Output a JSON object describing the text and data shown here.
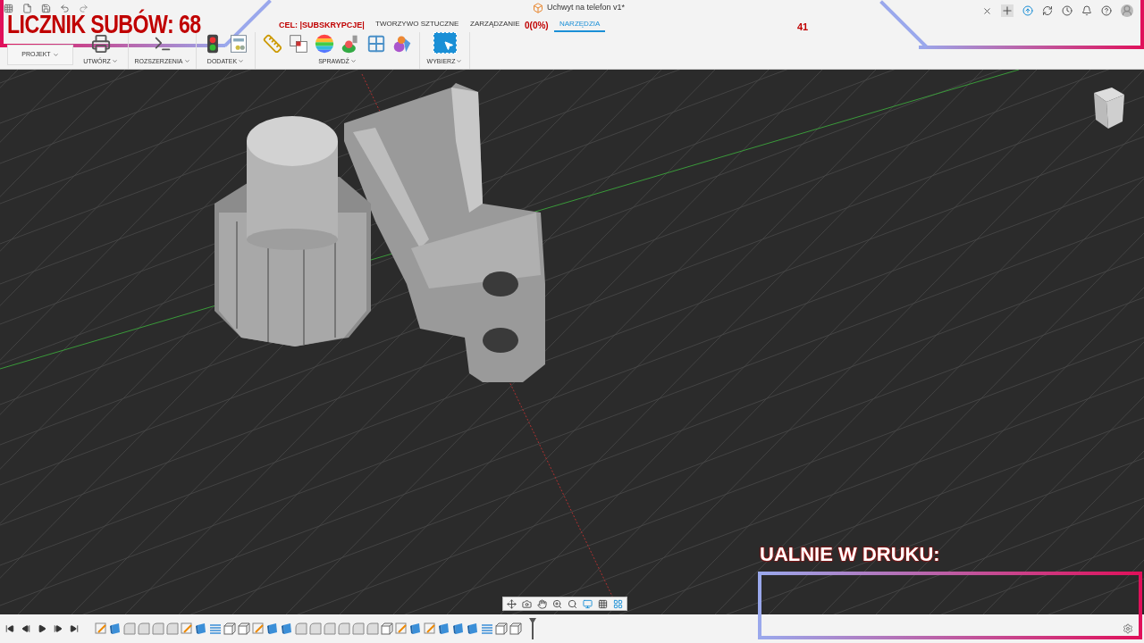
{
  "overlay": {
    "sub_counter": "LICZNIK SUBÓW: 68",
    "goal": "CEL: |SUBSKRYPCJE|",
    "progress": "0(0%)",
    "number": "41",
    "print_label": "UALNIE W DRUKU:"
  },
  "document_title": "Uchwyt na telefon v1*",
  "tabs": [
    {
      "label": "TWORZYWO SZTUCZNE",
      "selected": false
    },
    {
      "label": "ZARZĄDZANIE",
      "selected": false
    },
    {
      "label": "NARZĘDZIA",
      "selected": true
    }
  ],
  "project_button": "PROJEKT",
  "toolbar_groups": [
    {
      "label": "UTWÓRZ",
      "tools": [
        {
          "kind": "printer"
        }
      ]
    },
    {
      "label": "ROZSZERZENIA",
      "tools": [
        {
          "kind": "terminal"
        }
      ]
    },
    {
      "label": "DODATEK",
      "tools": [
        {
          "kind": "traffic"
        },
        {
          "kind": "report"
        }
      ]
    },
    {
      "label": "SPRAWDŹ",
      "tools": [
        {
          "kind": "measure"
        },
        {
          "kind": "interference"
        },
        {
          "kind": "curvature"
        },
        {
          "kind": "zebra"
        },
        {
          "kind": "section"
        },
        {
          "kind": "components"
        }
      ]
    },
    {
      "label": "WYBIERZ",
      "tools": [
        {
          "kind": "select"
        }
      ]
    }
  ],
  "timeline": [
    {
      "kind": "sketch"
    },
    {
      "kind": "body"
    },
    {
      "kind": "fillet"
    },
    {
      "kind": "fillet"
    },
    {
      "kind": "fillet"
    },
    {
      "kind": "fillet"
    },
    {
      "kind": "sketch"
    },
    {
      "kind": "body"
    },
    {
      "kind": "thread"
    },
    {
      "kind": "box"
    },
    {
      "kind": "box"
    },
    {
      "kind": "sketch"
    },
    {
      "kind": "body"
    },
    {
      "kind": "body"
    },
    {
      "kind": "fillet"
    },
    {
      "kind": "fillet"
    },
    {
      "kind": "fillet"
    },
    {
      "kind": "fillet"
    },
    {
      "kind": "fillet"
    },
    {
      "kind": "fillet"
    },
    {
      "kind": "box"
    },
    {
      "kind": "sketch"
    },
    {
      "kind": "body"
    },
    {
      "kind": "sketch"
    },
    {
      "kind": "body"
    },
    {
      "kind": "body"
    },
    {
      "kind": "body"
    },
    {
      "kind": "thread"
    },
    {
      "kind": "box"
    },
    {
      "kind": "box"
    }
  ]
}
